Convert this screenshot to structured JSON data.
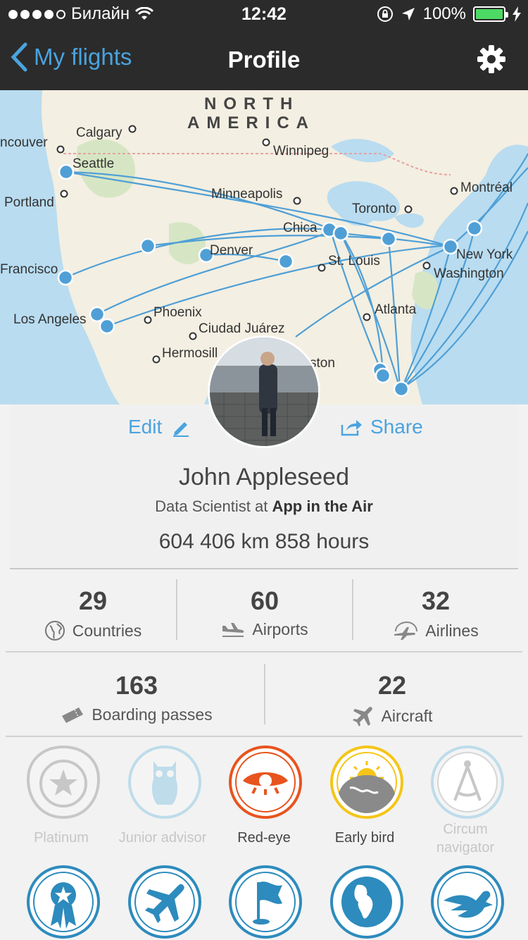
{
  "status_bar": {
    "carrier": "Билайн",
    "time": "12:42",
    "battery": "100%"
  },
  "nav": {
    "back_label": "My flights",
    "title": "Profile"
  },
  "map": {
    "continent_line1": "NORTH",
    "continent_line2": "AMERICA",
    "cities": {
      "vancouver": "ncouver",
      "calgary": "Calgary",
      "winnipeg": "Winnipeg",
      "seattle": "Seattle",
      "portland": "Portland",
      "minneapolis": "Minneapolis",
      "montreal": "Montréal",
      "toronto": "Toronto",
      "chicago": "Chica",
      "denver": "Denver",
      "st_louis": "St. Louis",
      "new_york": "New York",
      "washington": "Washington",
      "san_francisco": "Francisco",
      "los_angeles": "Los Angeles",
      "phoenix": "Phoenix",
      "ciudad_juarez": "Ciudad Juárez",
      "atlanta": "Atlanta",
      "hermosillo": "Hermosill",
      "houston": "ston"
    }
  },
  "profile": {
    "edit_label": "Edit",
    "share_label": "Share",
    "name": "John Appleseed",
    "job_prefix": "Data Scientist at ",
    "company": "App in the Air",
    "distance": "604 406 km 858 hours"
  },
  "stats": {
    "countries": {
      "value": "29",
      "label": "Countries"
    },
    "airports": {
      "value": "60",
      "label": "Airports"
    },
    "airlines": {
      "value": "32",
      "label": "Airlines"
    },
    "boarding_passes": {
      "value": "163",
      "label": "Boarding passes"
    },
    "aircraft": {
      "value": "22",
      "label": "Aircraft"
    }
  },
  "badges": {
    "platinum": "Platinum",
    "junior_advisor": "Junior advisor",
    "red_eye": "Red-eye",
    "early_bird": "Early bird",
    "circum_1": "Circum",
    "circum_2": "navigator"
  },
  "colors": {
    "accent": "#4aa3df",
    "red_eye": "#e8541e",
    "early_bird": "#f5c518",
    "badge_blue": "#2d8bbd"
  }
}
